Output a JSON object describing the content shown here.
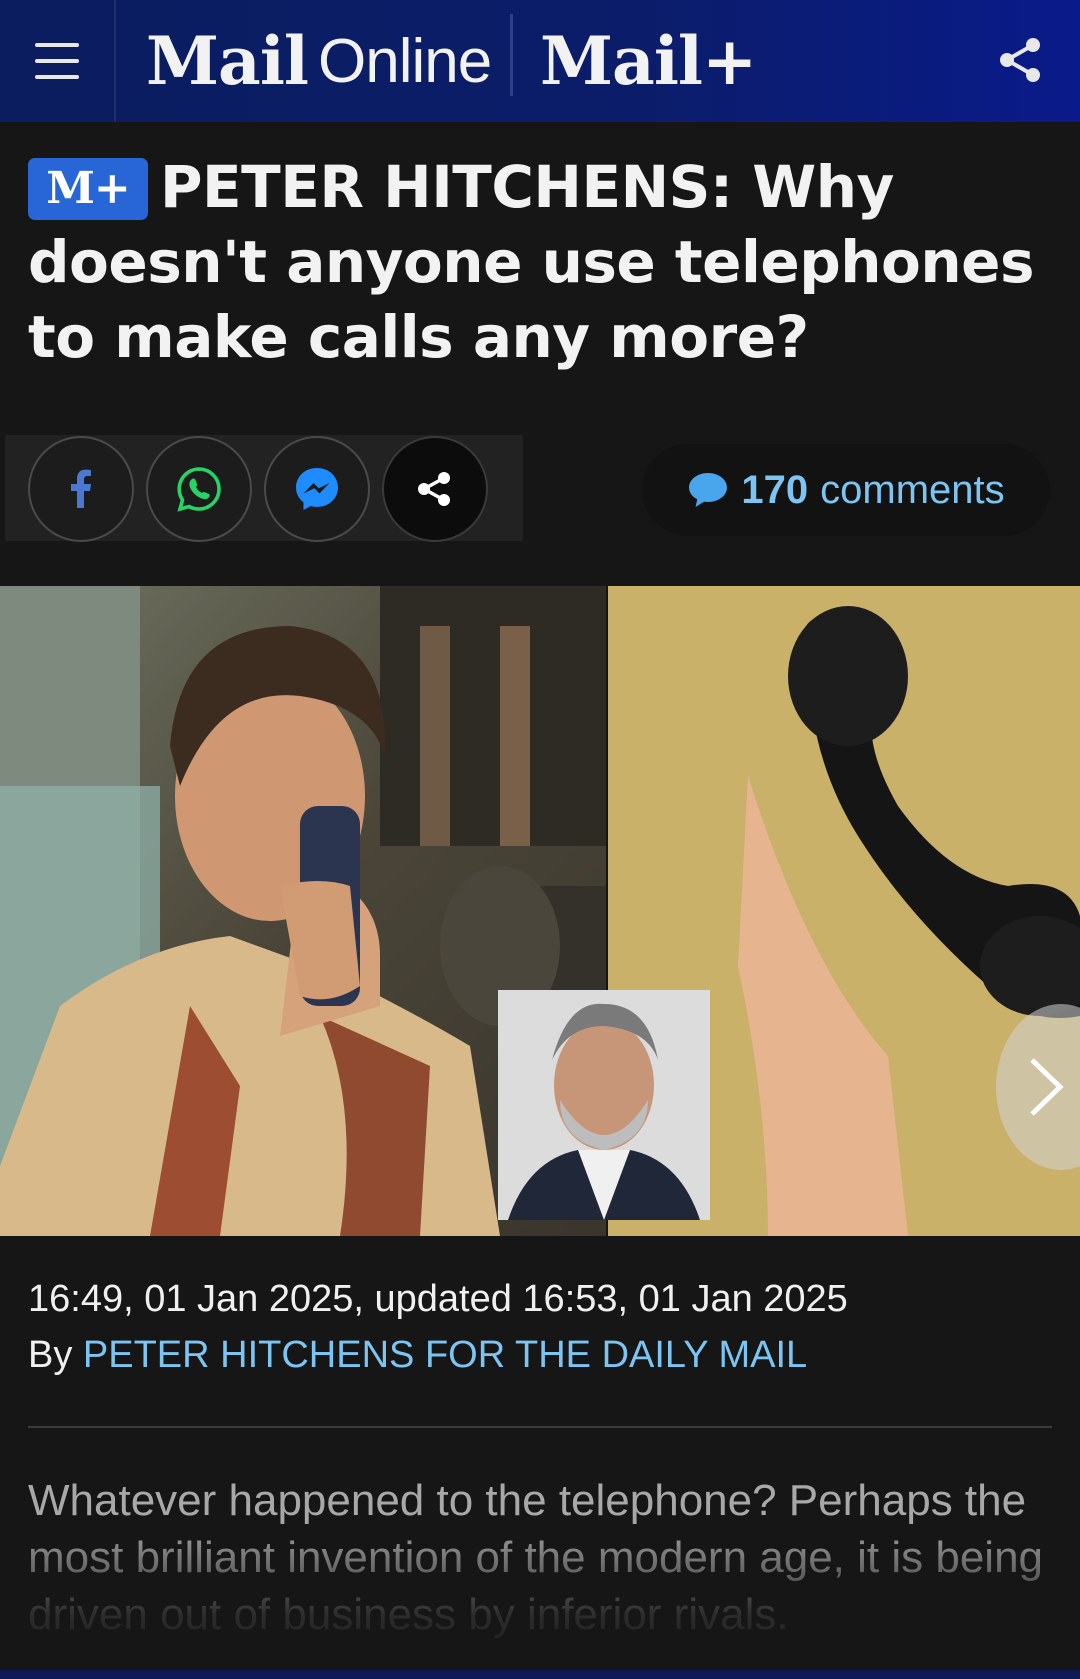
{
  "header": {
    "logo_mail": "Mail",
    "logo_online": "Online",
    "logo_mailplus": "Mail+",
    "menu_icon": "hamburger-menu-icon",
    "share_icon": "share-icon"
  },
  "article": {
    "badge": "M+",
    "headline": "PETER HITCHENS: Why doesn't anyone use telephones to make calls any more?",
    "share_buttons": [
      {
        "name": "facebook",
        "icon": "facebook-icon",
        "color": "#4b78d0"
      },
      {
        "name": "whatsapp",
        "icon": "whatsapp-icon",
        "color": "#25d366"
      },
      {
        "name": "messenger",
        "icon": "messenger-icon",
        "color": "#1e8cff"
      },
      {
        "name": "more",
        "icon": "share-icon",
        "color": "#ffffff"
      }
    ],
    "comments": {
      "count": "170",
      "label": "comments"
    },
    "timestamp": "16:49, 01 Jan 2025, updated 16:53, 01 Jan 2025",
    "byline_prefix": "By ",
    "byline_author": "PETER HITCHENS FOR THE DAILY MAIL",
    "body": "Whatever happened to the telephone? Perhaps the most brilliant invention of the modern age, it is being driven out of business by inferior rivals."
  },
  "colors": {
    "header_bg": "#0b1d5e",
    "page_bg": "#161616",
    "accent_link": "#7cc4f2",
    "badge_bg": "#2866d8"
  }
}
